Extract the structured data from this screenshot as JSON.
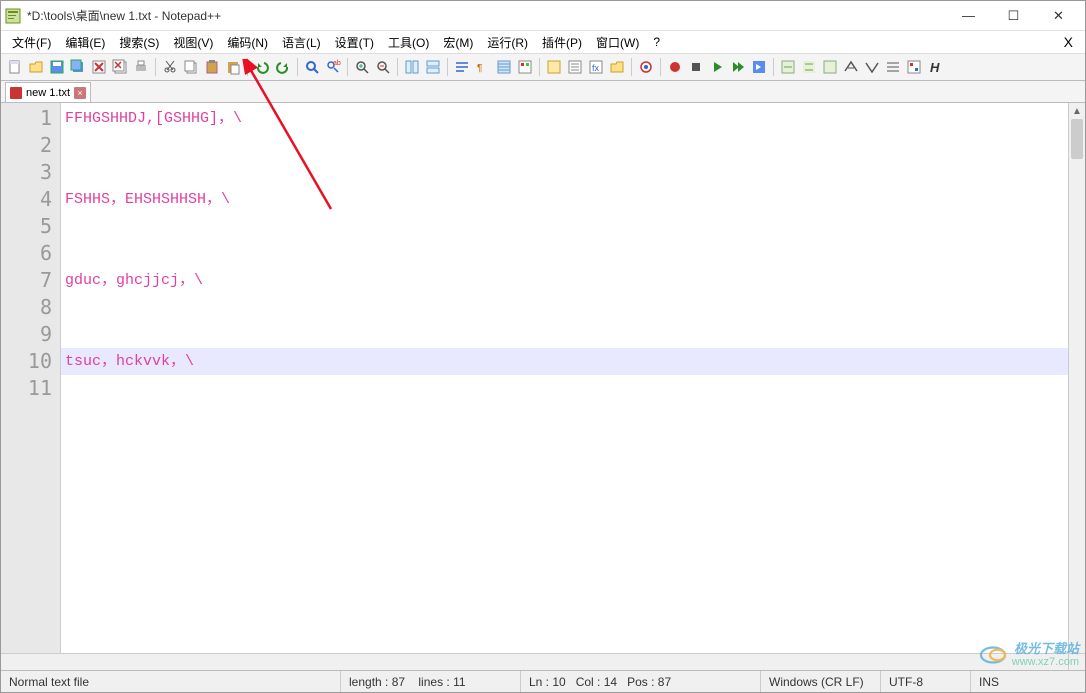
{
  "window": {
    "title": "*D:\\tools\\桌面\\new 1.txt - Notepad++",
    "minimize": "—",
    "maximize": "☐",
    "close": "✕"
  },
  "menu": {
    "items": [
      "文件(F)",
      "编辑(E)",
      "搜索(S)",
      "视图(V)",
      "编码(N)",
      "语言(L)",
      "设置(T)",
      "工具(O)",
      "宏(M)",
      "运行(R)",
      "插件(P)",
      "窗口(W)",
      "?"
    ],
    "close_x": "X"
  },
  "tab": {
    "label": "new 1.txt",
    "close": "×"
  },
  "editor": {
    "lines": [
      "FFHGSHHDJ,[GSHHG]，\\",
      "",
      "",
      "FSHHS，EHSHSHHSH，\\",
      "",
      "",
      "gduc，ghcjjcj，\\",
      "",
      "",
      "tsuc，hckvvk，\\",
      ""
    ],
    "current_line_index": 9,
    "line_count": 11
  },
  "status": {
    "filetype": "Normal text file",
    "length_label": "length : 87",
    "lines_label": "lines : 11",
    "ln_label": "Ln : 10",
    "col_label": "Col : 14",
    "pos_label": "Pos : 87",
    "eol": "Windows (CR LF)",
    "encoding": "UTF-8",
    "ins": "INS"
  },
  "watermark": {
    "top": "极光下载站",
    "bottom": "www.xz7.com"
  },
  "toolbar_icons": [
    "new-file",
    "open-file",
    "save",
    "save-all",
    "close",
    "close-all",
    "print",
    "sep",
    "cut",
    "copy",
    "paste",
    "paste-clipboard",
    "sep",
    "undo",
    "redo",
    "sep",
    "find",
    "replace",
    "sep",
    "zoom-in",
    "zoom-out",
    "sep",
    "sync-v",
    "sync-h",
    "sep",
    "word-wrap",
    "show-all",
    "indent-guide",
    "lang-user",
    "sep",
    "doc-map",
    "doc-list",
    "func-list",
    "folder",
    "sep",
    "monitor",
    "sep",
    "record-macro",
    "stop-macro",
    "play-macro",
    "play-multi",
    "save-macro",
    "sep",
    "spell1",
    "spell2",
    "spell3",
    "spell4",
    "spell5",
    "spell6",
    "spell7",
    "spell-h"
  ]
}
